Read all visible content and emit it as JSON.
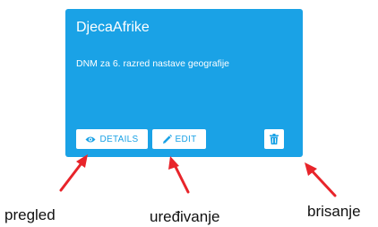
{
  "card": {
    "title": "DjecaAfrike",
    "description": "DNM za 6. razred nastave geografije",
    "buttons": {
      "details_label": "DETAILS",
      "edit_label": "EDIT"
    },
    "icons": {
      "details": "eye-icon",
      "edit": "pencil-icon",
      "delete": "trash-icon"
    }
  },
  "annotations": {
    "details": "pregled",
    "edit": "uređivanje",
    "delete": "brisanje"
  },
  "colors": {
    "card_background": "#1aa2e6",
    "button_background": "#ffffff",
    "arrow": "#e8242a"
  }
}
